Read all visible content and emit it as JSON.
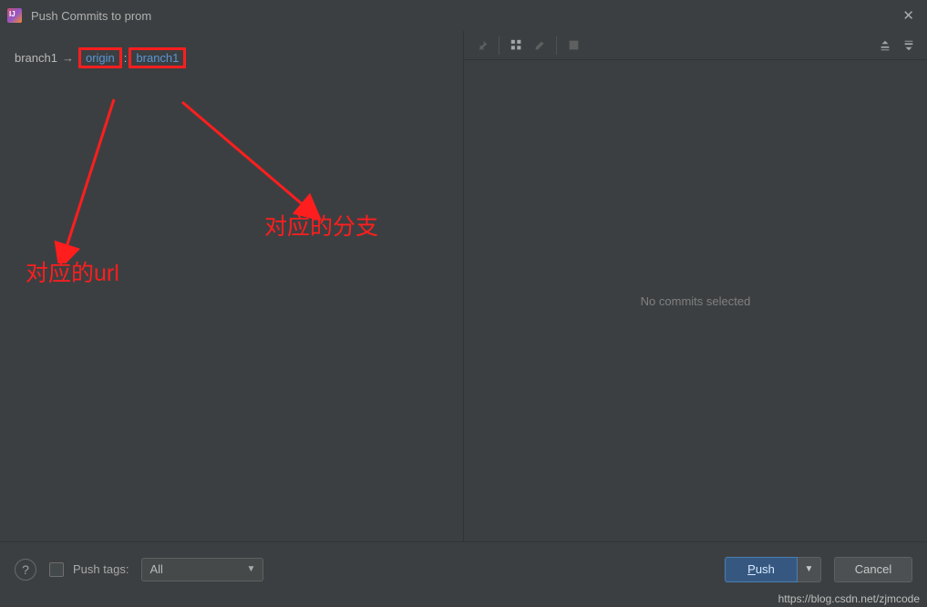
{
  "titlebar": {
    "title": "Push Commits to prom"
  },
  "branch": {
    "local": "branch1",
    "separator": "→",
    "remote": "origin",
    "colon": ":",
    "target": "branch1"
  },
  "annotations": {
    "url_label": "对应的url",
    "branch_label": "对应的分支"
  },
  "right": {
    "empty_text": "No commits selected"
  },
  "footer": {
    "push_tags_label": "Push tags:",
    "tag_select_value": "All",
    "push_label": "Push",
    "cancel_label": "Cancel"
  },
  "watermark": "https://blog.csdn.net/zjmcode"
}
